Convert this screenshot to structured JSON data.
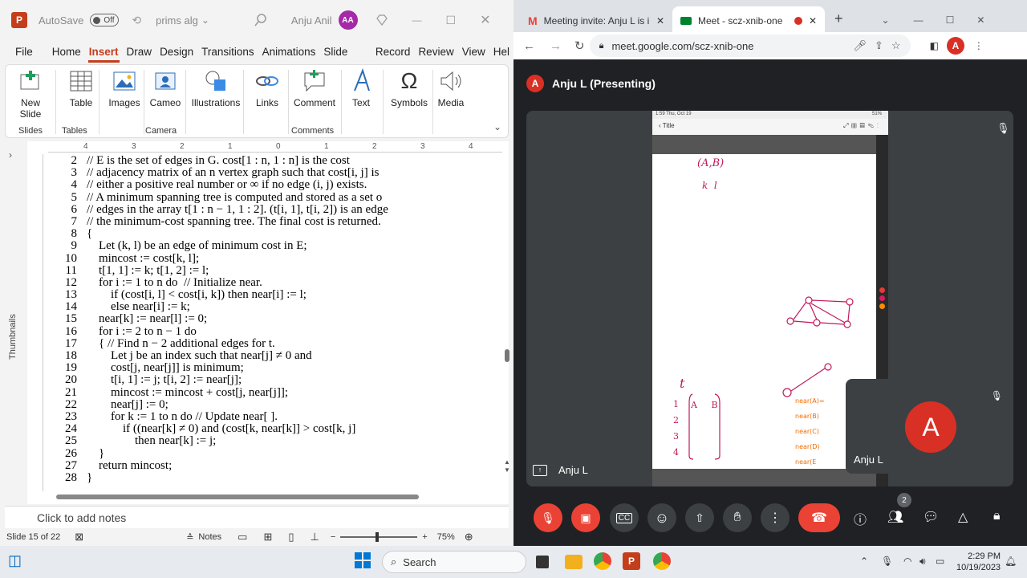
{
  "ppt": {
    "autosave_label": "AutoSave",
    "autosave_state": "Off",
    "file_name": "prims alg",
    "user_name": "Anju Anil",
    "user_initials": "AA",
    "tabs": [
      "File",
      "Home",
      "Insert",
      "Draw",
      "Design",
      "Transitions",
      "Animations",
      "Slide Show",
      "Record",
      "Review",
      "View",
      "Hel"
    ],
    "active_tab": "Insert",
    "ribbon": {
      "new_slide": [
        "New",
        "Slide"
      ],
      "table": "Table",
      "images": "Images",
      "cameo": "Cameo",
      "illustrations": "Illustrations",
      "links": "Links",
      "comment": "Comment",
      "text": "Text",
      "symbols": "Symbols",
      "media": "Media",
      "groups": {
        "slides": "Slides",
        "tables": "Tables",
        "camera": "Camera",
        "comments": "Comments"
      }
    },
    "thumbnails_label": "Thumbnails",
    "ruler_h": [
      "4",
      "3",
      "2",
      "1",
      "0",
      "1",
      "2",
      "3",
      "4"
    ],
    "code_lines": [
      {
        "n": "2",
        "t": "// E is the set of edges in G. cost[1 : n, 1 : n] is the cost"
      },
      {
        "n": "3",
        "t": "// adjacency matrix of an n vertex graph such that cost[i, j] is"
      },
      {
        "n": "4",
        "t": "// either a positive real number or ∞ if no edge (i, j) exists."
      },
      {
        "n": "5",
        "t": "// A minimum spanning tree is computed and stored as a set o"
      },
      {
        "n": "6",
        "t": "// edges in the array t[1 : n − 1, 1 : 2]. (t[i, 1], t[i, 2]) is an edge"
      },
      {
        "n": "7",
        "t": "// the minimum-cost spanning tree. The final cost is returned."
      },
      {
        "n": "8",
        "t": "{"
      },
      {
        "n": "9",
        "t": "    Let (k, l) be an edge of minimum cost in E;"
      },
      {
        "n": "10",
        "t": "    mincost := cost[k, l];"
      },
      {
        "n": "11",
        "t": "    t[1, 1] := k; t[1, 2] := l;"
      },
      {
        "n": "12",
        "t": "    for i := 1 to n do  // Initialize near."
      },
      {
        "n": "13",
        "t": "        if (cost[i, l] < cost[i, k]) then near[i] := l;"
      },
      {
        "n": "14",
        "t": "        else near[i] := k;"
      },
      {
        "n": "15",
        "t": "    near[k] := near[l] := 0;"
      },
      {
        "n": "16",
        "t": "    for i := 2 to n − 1 do"
      },
      {
        "n": "17",
        "t": "    { // Find n − 2 additional edges for t."
      },
      {
        "n": "18",
        "t": "        Let j be an index such that near[j] ≠ 0 and"
      },
      {
        "n": "19",
        "t": "        cost[j, near[j]] is minimum;"
      },
      {
        "n": "20",
        "t": "        t[i, 1] := j; t[i, 2] := near[j];"
      },
      {
        "n": "21",
        "t": "        mincost := mincost + cost[j, near[j]];"
      },
      {
        "n": "22",
        "t": "        near[j] := 0;"
      },
      {
        "n": "23",
        "t": "        for k := 1 to n do // Update near[ ]."
      },
      {
        "n": "24",
        "t": "            if ((near[k] ≠ 0) and (cost[k, near[k]] > cost[k, j]"
      },
      {
        "n": "25",
        "t": "                then near[k] := j;"
      },
      {
        "n": "26",
        "t": "    }"
      },
      {
        "n": "27",
        "t": "    return mincost;"
      },
      {
        "n": "28",
        "t": "}"
      }
    ],
    "notes_placeholder": "Click to add notes",
    "status": {
      "slide": "Slide 15 of 22",
      "notes": "Notes",
      "zoom": "75%"
    }
  },
  "chrome": {
    "tabs": [
      {
        "title": "Meeting invite: Anju L is in"
      },
      {
        "title": "Meet - scz-xnib-one"
      }
    ],
    "url": "meet.google.com/scz-xnib-one",
    "profile_initial": "A"
  },
  "meet": {
    "presenter_initial": "A",
    "presenter_title": "Anju L (Presenting)",
    "shared_label": "Anju L",
    "self_initial": "A",
    "self_name": "Anju L",
    "people_count": "2",
    "tablet": {
      "status_left": "1:59  Thu, Oct 19",
      "status_right": "51%",
      "doc_title": "Title",
      "ink_pair": "(A,B)",
      "ink_kl": "k  l",
      "ink_t": "t",
      "ink_rows": [
        "1",
        "2",
        "3",
        "4"
      ],
      "ink_cells": [
        "A",
        "B"
      ],
      "ink_near": [
        "near(A)=",
        "near(B)",
        "near(C)",
        "near(D)",
        "near(E"
      ]
    }
  },
  "taskbar": {
    "search": "Search",
    "time": "2:29 PM",
    "date": "10/19/2023"
  }
}
